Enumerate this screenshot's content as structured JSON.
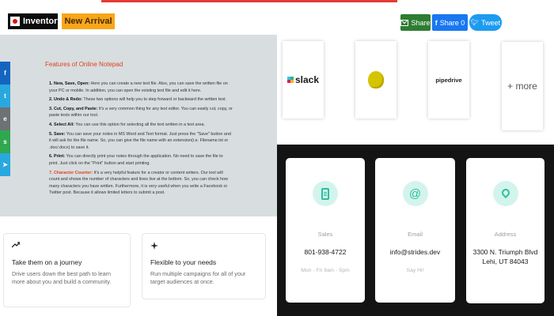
{
  "badges": {
    "inventory": "Inventory",
    "new_arrival": "New Arrival"
  },
  "notepad": {
    "title": "Features of Online Notepad",
    "items": [
      {
        "label": "1. New, Save, Open:",
        "text": " Here you can create a new text file. Also, you can save the written file on your PC or mobile. In addition, you can open the existing text file and edit it here."
      },
      {
        "label": "2. Undo & Redo:",
        "text": " These two options will help you to step forward or backward the written text."
      },
      {
        "label": "3. Cut, Copy, and Paste:",
        "text": " It's a very common thing for any text editor. You can easily cut, copy, or paste texts within our tool."
      },
      {
        "label": "4. Select All:",
        "text": " You can use this option for selecting all the text written in a text area."
      },
      {
        "label": "5. Save:",
        "text": " You can save your notes in MS Word and Text format. Just press the \"Save\" button and it will ask for the file name. So, you can give the file name with an extension(i.e. Filename.txt or .doc/.docx) to save it."
      },
      {
        "label": "6. Print:",
        "text": " You can directly print your notes through the application. No need to save the file to print. Just click on the \"Print\" button and start printing."
      },
      {
        "label": "7. Character Counter:",
        "text": " It's a very helpful feature for a creator or content writers. Our tool will count and shows the number of characters and lines live at the bottom. So, you can check how many characters you have written. Furthermore, it is very useful when you write a Facebook or Twitter post. Because it allows limited letters to submit a post."
      }
    ]
  },
  "sidebar_share": {
    "facebook": "f",
    "twitter": "t",
    "email": "e",
    "sms": "s",
    "share": "➤"
  },
  "features": {
    "journey": {
      "icon": "trend-arrow-icon",
      "title": "Take them on a journey",
      "body": "Drive users down the best path to learn more about you and build a community."
    },
    "flexible": {
      "icon": "sparkle-icon",
      "title": "Flexible to your needs",
      "body": "Run multiple campaigns for all of your target audiences at once."
    }
  },
  "share_bar": {
    "email": "Share",
    "facebook": "Share 0",
    "twitter": "Tweet"
  },
  "integrations": {
    "slack": "slack",
    "pipedrive": "pipedrive",
    "more": "+ more"
  },
  "contact": {
    "sales": {
      "label": "Sales",
      "value": "801-938-4722",
      "sub": "Mon - Fri 9am - 5pm"
    },
    "email": {
      "label": "Email",
      "value": "info@strides.dev",
      "sub": "Say Hi!"
    },
    "address": {
      "label": "Address",
      "line1": "3300 N. Triumph Blvd",
      "line2": "Lehi, UT 84043"
    }
  },
  "colors": {
    "accent_red": "#e53935",
    "new_arrival": "#f7a61a",
    "contact_bg": "#141414",
    "icon_teal": "#2bbf9e"
  }
}
